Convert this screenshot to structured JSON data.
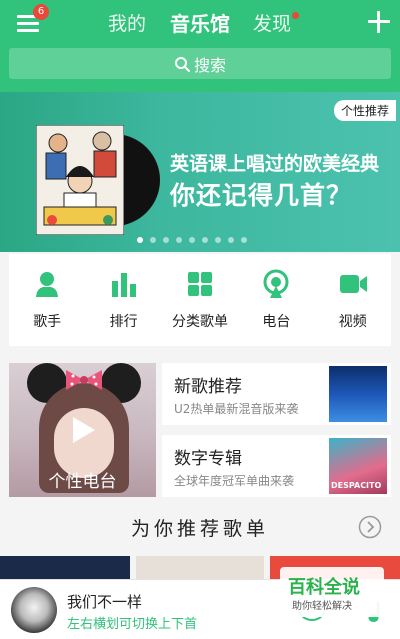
{
  "colors": {
    "accent": "#31c27c",
    "badge": "#e64a3b"
  },
  "header": {
    "menu_badge": "6",
    "tabs": [
      {
        "label": "我的",
        "active": false
      },
      {
        "label": "音乐馆",
        "active": true
      },
      {
        "label": "发现",
        "active": false
      }
    ],
    "search_placeholder": "搜索"
  },
  "banner": {
    "tag": "个性推荐",
    "line1": "英语课上唱过的欧美经典",
    "line2": "你还记得几首？",
    "active_dot": 0,
    "dot_count": 9
  },
  "quicknav": [
    {
      "label": "歌手",
      "icon": "singer-icon"
    },
    {
      "label": "排行",
      "icon": "chart-icon"
    },
    {
      "label": "分类歌单",
      "icon": "category-icon"
    },
    {
      "label": "电台",
      "icon": "radio-icon"
    },
    {
      "label": "视频",
      "icon": "video-icon"
    }
  ],
  "radio_card": {
    "label": "个性电台"
  },
  "cards": [
    {
      "title": "新歌推荐",
      "subtitle": "U2热单最新混音版来袭"
    },
    {
      "title": "数字专辑",
      "subtitle": "全球年度冠军单曲来袭",
      "thumb_text": "DESPACITO"
    }
  ],
  "playlist_section": {
    "title": "为你推荐歌单"
  },
  "player": {
    "song": "我们不一样",
    "hint": "左右横划可切换上下首"
  },
  "watermark": {
    "title": "百科全说",
    "subtitle": "助你轻松解决"
  }
}
